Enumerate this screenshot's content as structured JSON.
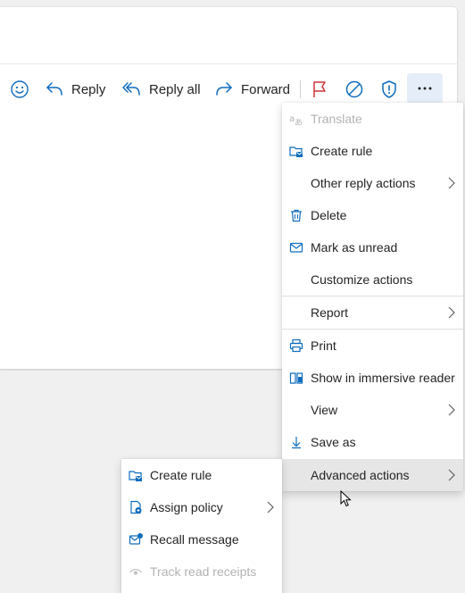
{
  "toolbar": {
    "reply_label": "Reply",
    "reply_all_label": "Reply all",
    "forward_label": "Forward"
  },
  "menu": {
    "items": [
      {
        "label": "Translate",
        "icon": "translate-icon",
        "enabled": false,
        "submenu": false
      },
      {
        "label": "Create rule",
        "icon": "create-rule-icon",
        "enabled": true,
        "submenu": false
      },
      {
        "label": "Other reply actions",
        "icon": "",
        "enabled": true,
        "submenu": true
      },
      {
        "label": "Delete",
        "icon": "trash-icon",
        "enabled": true,
        "submenu": false
      },
      {
        "label": "Mark as unread",
        "icon": "envelope-icon",
        "enabled": true,
        "submenu": false
      },
      {
        "label": "Customize actions",
        "icon": "",
        "enabled": true,
        "submenu": false
      },
      {
        "label": "Report",
        "icon": "",
        "enabled": true,
        "submenu": true
      },
      {
        "label": "Print",
        "icon": "printer-icon",
        "enabled": true,
        "submenu": false
      },
      {
        "label": "Show in immersive reader",
        "icon": "immersive-reader-icon",
        "enabled": true,
        "submenu": false
      },
      {
        "label": "View",
        "icon": "",
        "enabled": true,
        "submenu": true
      },
      {
        "label": "Save as",
        "icon": "download-icon",
        "enabled": true,
        "submenu": false
      },
      {
        "label": "Advanced actions",
        "icon": "",
        "enabled": true,
        "submenu": true,
        "highlighted": true
      }
    ]
  },
  "submenu": {
    "items": [
      {
        "label": "Create rule",
        "icon": "create-rule-icon",
        "enabled": true,
        "submenu": false
      },
      {
        "label": "Assign policy",
        "icon": "assign-policy-icon",
        "enabled": true,
        "submenu": true
      },
      {
        "label": "Recall message",
        "icon": "recall-message-icon",
        "enabled": true,
        "submenu": false
      },
      {
        "label": "Track read receipts",
        "icon": "eye-icon",
        "enabled": false,
        "submenu": false
      }
    ]
  },
  "colors": {
    "accent": "#0f6cbd",
    "disabled_text": "#b3b3b3",
    "hover_bg": "#e6e6e6",
    "page_bg": "#f0f0f0"
  }
}
